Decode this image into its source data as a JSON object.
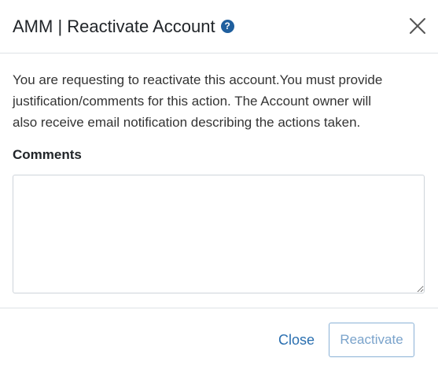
{
  "dialog": {
    "title": "AMM | Reactivate Account",
    "help_icon": "question-circle-icon",
    "help_glyph": "?",
    "close_icon": "close-x-icon"
  },
  "body": {
    "message_line1": "You are requesting to reactivate this account.You must provide",
    "message_line2": "justification/comments for this action. The Account owner will",
    "message_line3": "also receive email notification describing the actions taken.",
    "comments_label": "Comments",
    "comments_value": "",
    "comments_placeholder": ""
  },
  "footer": {
    "close_label": "Close",
    "reactivate_label": "Reactivate",
    "reactivate_disabled": true
  },
  "colors": {
    "link_blue": "#2a6fb0",
    "help_icon_bg": "#1f5f9e",
    "disabled_button_text": "#7aa3cb",
    "disabled_button_border": "#8ab1d6",
    "divider": "#dee2e6"
  }
}
